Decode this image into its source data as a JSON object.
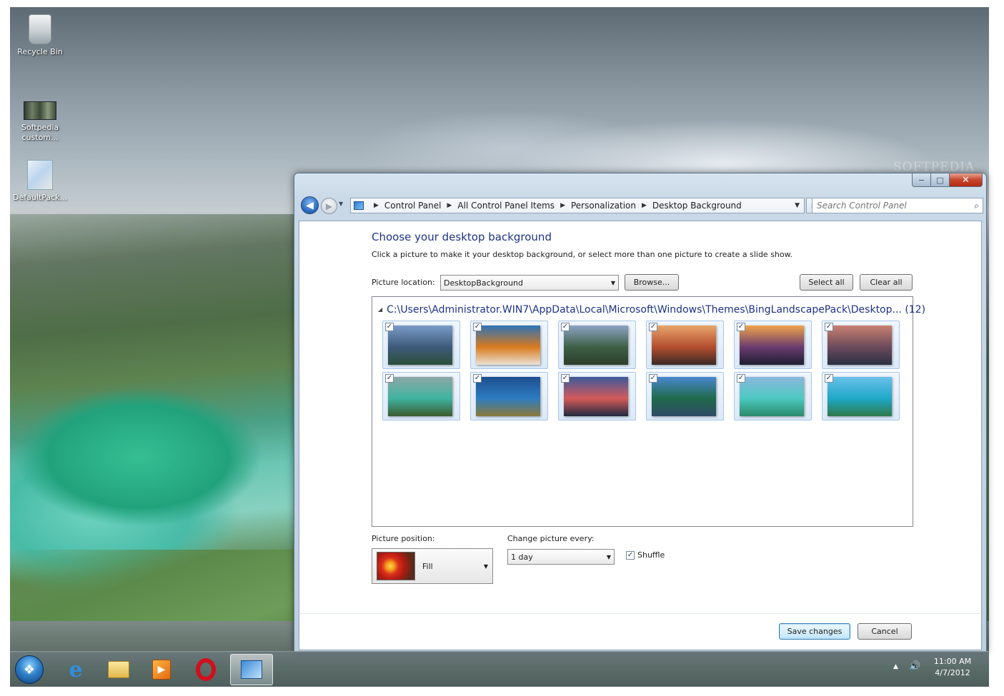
{
  "desktop": {
    "icons": [
      {
        "label": "Recycle Bin"
      },
      {
        "label": "Softpedia custom..."
      },
      {
        "label": "DefaultPack..."
      }
    ],
    "watermark": "SOFTPEDIA"
  },
  "window": {
    "caption": {
      "minimize": "−",
      "maximize": "□",
      "close": "✕"
    },
    "breadcrumb": [
      "Control Panel",
      "All Control Panel Items",
      "Personalization",
      "Desktop Background"
    ],
    "search_placeholder": "Search Control Panel",
    "title": "Choose your desktop background",
    "description": "Click a picture to make it your desktop background, or select more than one picture to create a slide show.",
    "picture_location_label": "Picture location:",
    "picture_location_value": "DesktopBackground",
    "browse_label": "Browse...",
    "select_all_label": "Select all",
    "clear_all_label": "Clear all",
    "group_path": "C:\\Users\\Administrator.WIN7\\AppData\\Local\\Microsoft\\Windows\\Themes\\BingLandscapePack\\Desktop...",
    "group_count": "(12)",
    "thumbnails": [
      {
        "checked": true,
        "colors": [
          "#7a9cc8",
          "#3d5a7a",
          "#2c4f3a"
        ]
      },
      {
        "checked": true,
        "colors": [
          "#2d73b5",
          "#d97a1e",
          "#e9e2d4"
        ]
      },
      {
        "checked": true,
        "colors": [
          "#8ca3c4",
          "#3e6046",
          "#2c3d2a"
        ]
      },
      {
        "checked": true,
        "colors": [
          "#e8a36a",
          "#b34e2f",
          "#3a2a25"
        ]
      },
      {
        "checked": true,
        "colors": [
          "#f0a34a",
          "#6a3b6e",
          "#1e1f32"
        ]
      },
      {
        "checked": true,
        "colors": [
          "#c98070",
          "#6a4a5c",
          "#2a3042"
        ]
      },
      {
        "checked": true,
        "colors": [
          "#8da7a6",
          "#3fb3a0",
          "#3b5a2f"
        ]
      },
      {
        "checked": true,
        "colors": [
          "#1d4f8f",
          "#2d7cc0",
          "#8b7a3a"
        ]
      },
      {
        "checked": true,
        "colors": [
          "#3b5a9a",
          "#d45a5a",
          "#1f2a3f"
        ]
      },
      {
        "checked": true,
        "colors": [
          "#4a88d0",
          "#1f6a4a",
          "#2e4a66"
        ]
      },
      {
        "checked": true,
        "colors": [
          "#8ab8e0",
          "#4cc9c0",
          "#2a8a6a"
        ]
      },
      {
        "checked": true,
        "colors": [
          "#6ac0ea",
          "#1ea8c8",
          "#2e7a4a"
        ]
      }
    ],
    "picture_position_label": "Picture position:",
    "picture_position_value": "Fill",
    "change_picture_label": "Change picture every:",
    "change_picture_value": "1 day",
    "shuffle_label": "Shuffle",
    "shuffle_checked": true,
    "save_label": "Save changes",
    "cancel_label": "Cancel"
  },
  "taskbar": {
    "start_glyph": "❖",
    "ie_glyph": "e",
    "media_glyph": "▶",
    "tray_up_glyph": "▲",
    "volume_glyph": "🔊",
    "time": "11:00 AM",
    "date": "4/7/2012"
  }
}
